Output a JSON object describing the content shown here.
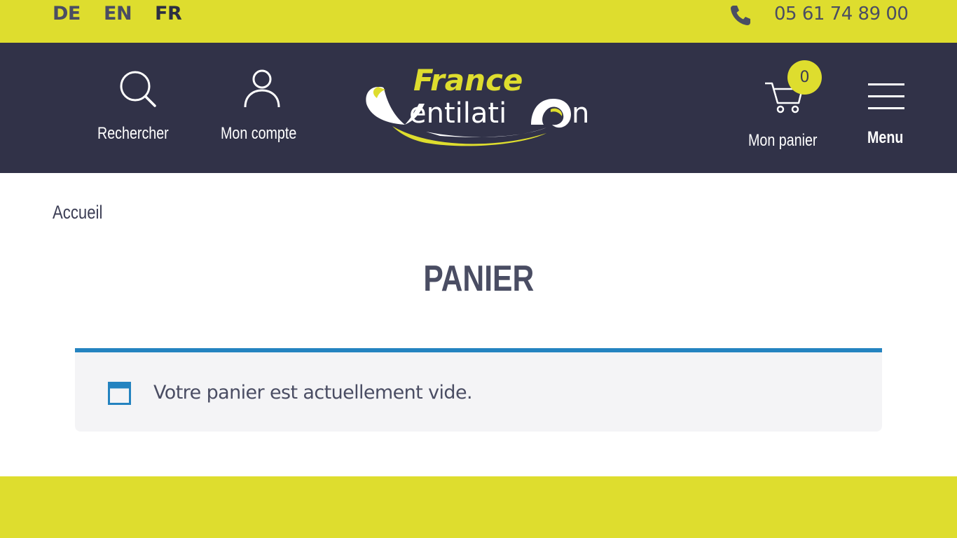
{
  "topbar": {
    "languages": [
      "DE",
      "EN",
      "FR"
    ],
    "active_language": "FR",
    "phone_number": "05 61 74 89 00",
    "phone_icon": "phone-icon"
  },
  "header": {
    "search_label": "Rechercher",
    "account_label": "Mon compte",
    "logo": {
      "line1": "France",
      "line2": "Ventilation"
    },
    "cart_count": "0",
    "cart_label": "Mon panier",
    "menu_label": "Menu"
  },
  "breadcrumb": {
    "home": "Accueil"
  },
  "page": {
    "title": "PANIER",
    "notice": "Votre panier est actuellement vide."
  },
  "colors": {
    "brand_yellow": "#dedd2e",
    "header_navy": "#313248",
    "notice_blue": "#2483c0",
    "text_dark": "#4a4d63"
  }
}
